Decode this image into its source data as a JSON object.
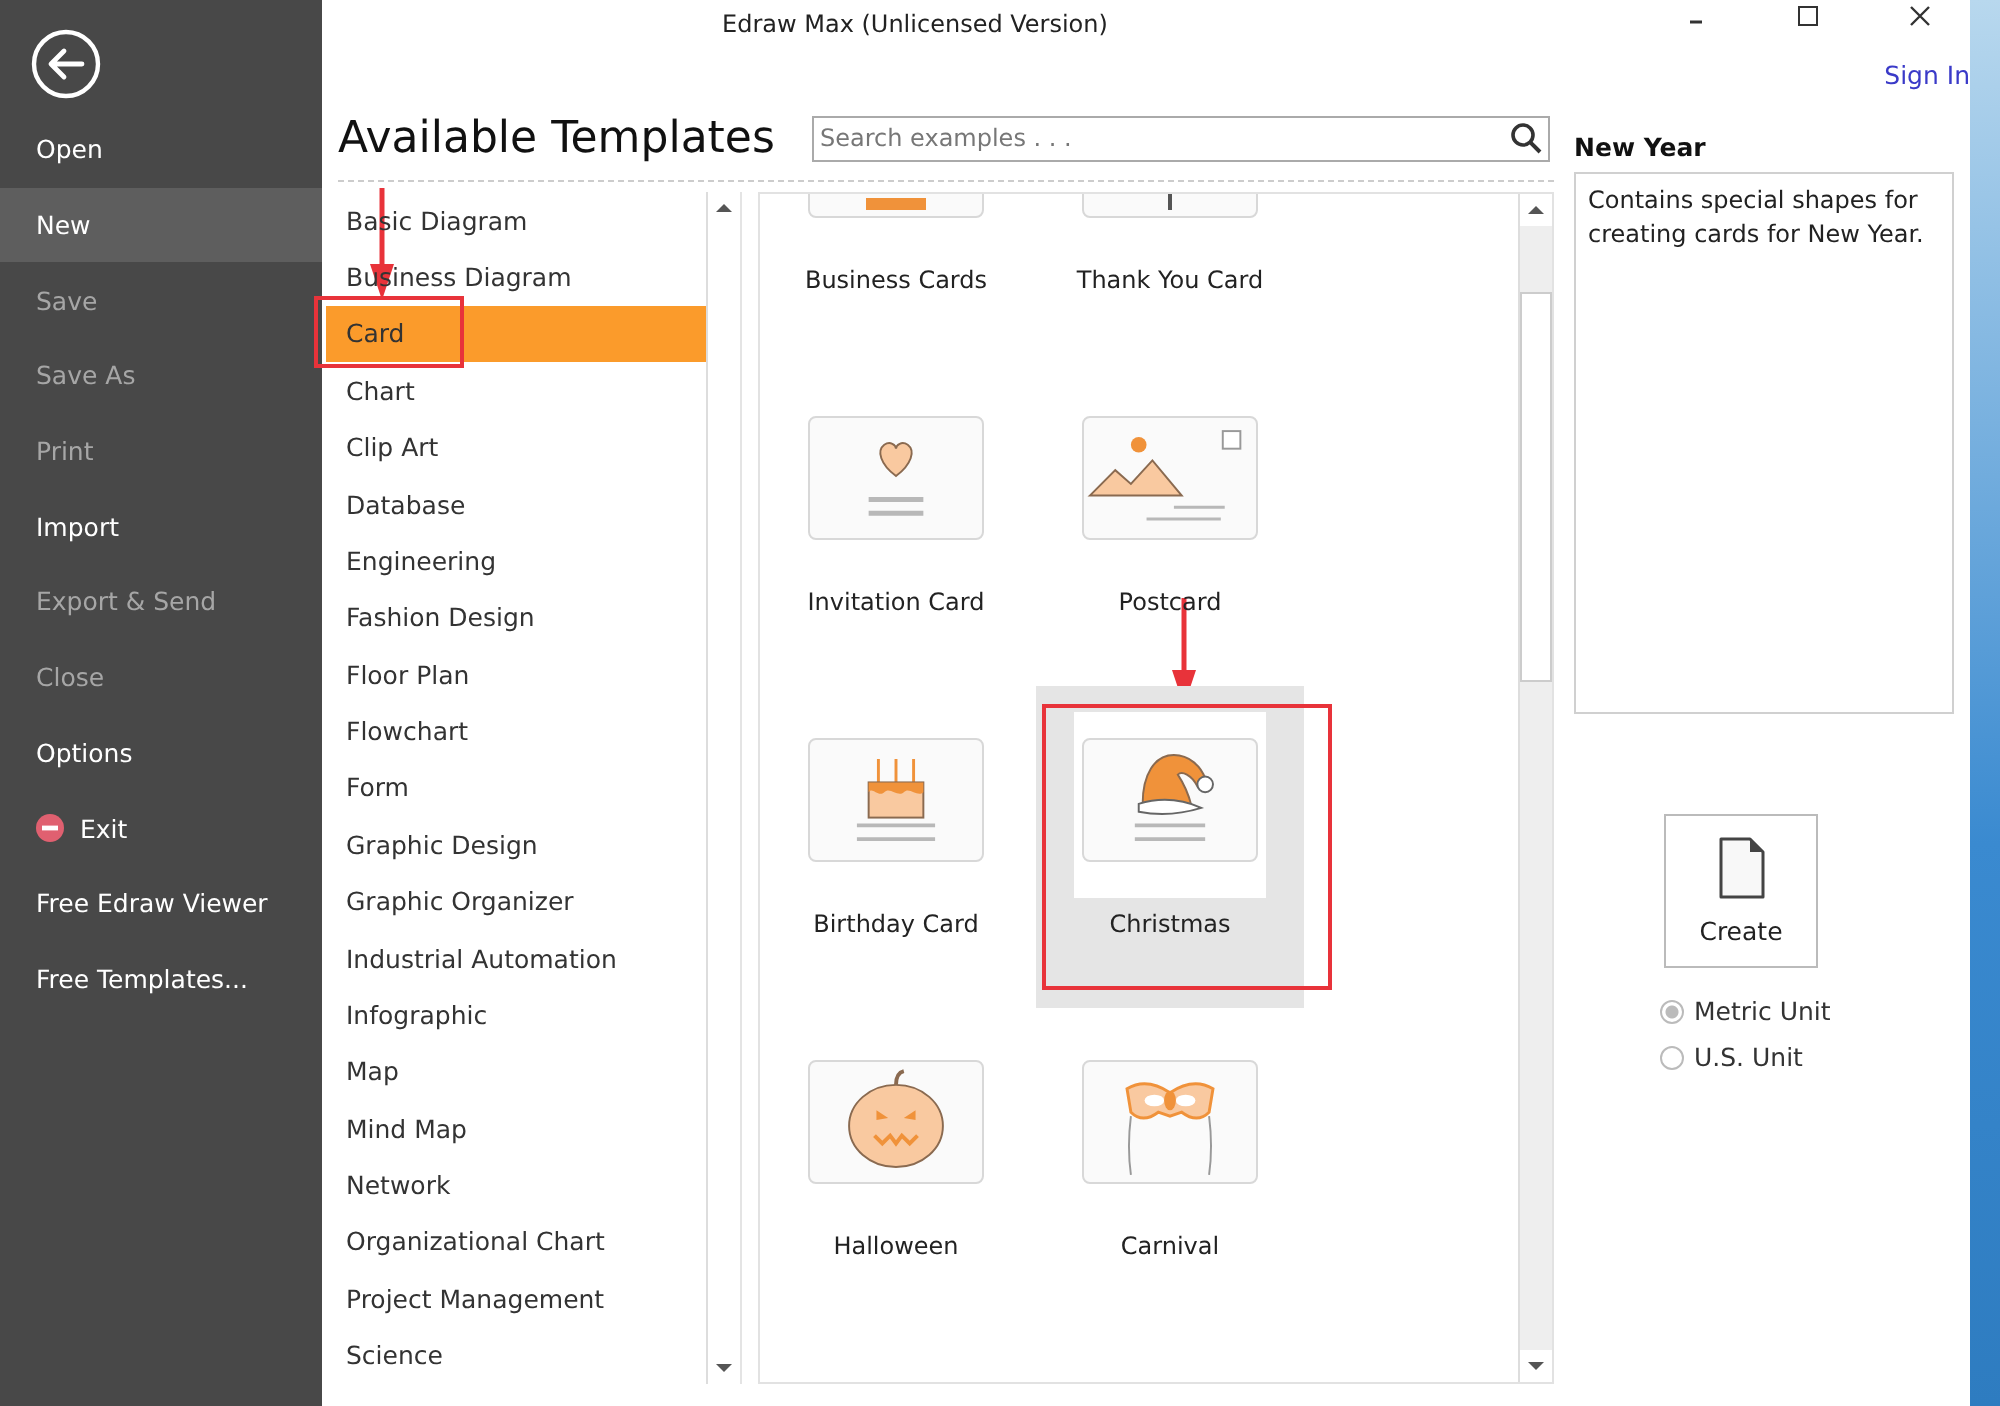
{
  "window": {
    "title": "Edraw Max (Unlicensed Version)",
    "sign_in": "Sign In"
  },
  "sidebar": {
    "items": [
      {
        "label": "Open",
        "kind": "plain",
        "disabled": false,
        "selected": false
      },
      {
        "label": "New",
        "kind": "plain",
        "disabled": false,
        "selected": true
      },
      {
        "label": "Save",
        "kind": "plain",
        "disabled": true,
        "selected": false
      },
      {
        "label": "Save As",
        "kind": "plain",
        "disabled": true,
        "selected": false
      },
      {
        "label": "Print",
        "kind": "plain",
        "disabled": true,
        "selected": false
      },
      {
        "label": "Import",
        "kind": "plain",
        "disabled": false,
        "selected": false
      },
      {
        "label": "Export & Send",
        "kind": "plain",
        "disabled": true,
        "selected": false
      },
      {
        "label": "Close",
        "kind": "plain",
        "disabled": true,
        "selected": false
      },
      {
        "label": "Options",
        "kind": "plain",
        "disabled": false,
        "selected": false
      },
      {
        "label": "Exit",
        "kind": "exit",
        "disabled": false,
        "selected": false
      },
      {
        "label": "Free Edraw Viewer",
        "kind": "plain",
        "disabled": false,
        "selected": false
      },
      {
        "label": "Free Templates...",
        "kind": "plain",
        "disabled": false,
        "selected": false
      }
    ]
  },
  "heading": "Available Templates",
  "search": {
    "placeholder": "Search examples . . ."
  },
  "categories": [
    {
      "label": "Basic Diagram",
      "selected": false
    },
    {
      "label": "Business Diagram",
      "selected": false
    },
    {
      "label": "Card",
      "selected": true
    },
    {
      "label": "Chart",
      "selected": false
    },
    {
      "label": "Clip Art",
      "selected": false
    },
    {
      "label": "Database",
      "selected": false
    },
    {
      "label": "Engineering",
      "selected": false
    },
    {
      "label": "Fashion Design",
      "selected": false
    },
    {
      "label": "Floor Plan",
      "selected": false
    },
    {
      "label": "Flowchart",
      "selected": false
    },
    {
      "label": "Form",
      "selected": false
    },
    {
      "label": "Graphic Design",
      "selected": false
    },
    {
      "label": "Graphic Organizer",
      "selected": false
    },
    {
      "label": "Industrial Automation",
      "selected": false
    },
    {
      "label": "Infographic",
      "selected": false
    },
    {
      "label": "Map",
      "selected": false
    },
    {
      "label": "Mind Map",
      "selected": false
    },
    {
      "label": "Network",
      "selected": false
    },
    {
      "label": "Organizational Chart",
      "selected": false
    },
    {
      "label": "Project Management",
      "selected": false
    },
    {
      "label": "Science",
      "selected": false
    }
  ],
  "templates": [
    {
      "label": "Business Cards",
      "kind": "business",
      "selected": false
    },
    {
      "label": "Thank You Card",
      "kind": "thanks",
      "selected": false
    },
    {
      "label": "Invitation Card",
      "kind": "invitation",
      "selected": false
    },
    {
      "label": "Postcard",
      "kind": "postcard",
      "selected": false
    },
    {
      "label": "Birthday Card",
      "kind": "birthday",
      "selected": false
    },
    {
      "label": "Christmas",
      "kind": "christmas",
      "selected": true
    },
    {
      "label": "Halloween",
      "kind": "halloween",
      "selected": false
    },
    {
      "label": "Carnival",
      "kind": "carnival",
      "selected": false
    }
  ],
  "details": {
    "title": "New Year",
    "description": "Contains special shapes for creating cards for New Year.",
    "create_button": "Create",
    "units": [
      {
        "label": "Metric Unit",
        "selected": true
      },
      {
        "label": "U.S. Unit",
        "selected": false
      }
    ]
  }
}
